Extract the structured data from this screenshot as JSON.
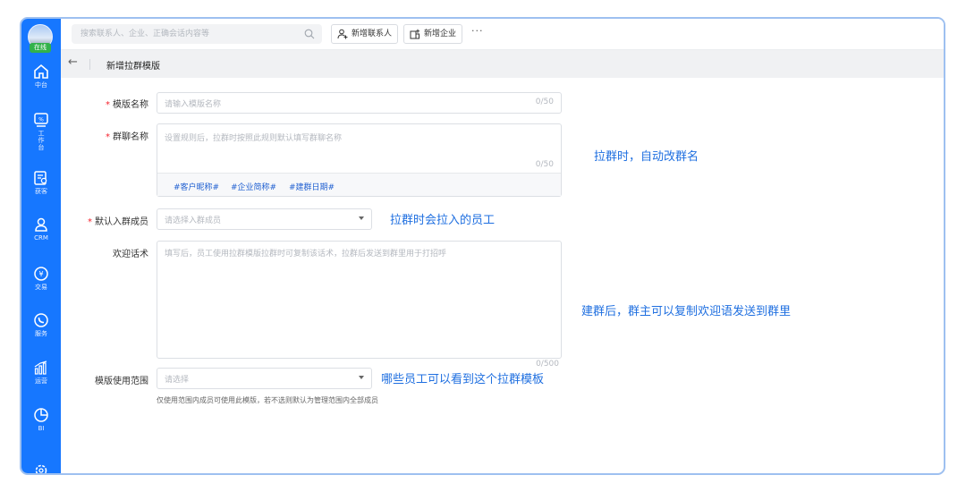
{
  "sidebar": {
    "status": "在线",
    "items": [
      {
        "label": "中台",
        "icon": "home-icon"
      },
      {
        "label": "工作台",
        "icon": "workbench-icon"
      },
      {
        "label": "获客",
        "icon": "acquire-icon"
      },
      {
        "label": "CRM",
        "icon": "user-icon"
      },
      {
        "label": "交易",
        "icon": "yen-icon"
      },
      {
        "label": "服务",
        "icon": "phone-chat-icon"
      },
      {
        "label": "运营",
        "icon": "bar-chart-icon"
      },
      {
        "label": "BI",
        "icon": "pie-chart-icon"
      }
    ]
  },
  "topbar": {
    "search_placeholder": "搜索联系人、企业、正确会话内容等",
    "add_contact": "新增联系人",
    "add_company": "新增企业",
    "more": "···"
  },
  "subheader": {
    "back": "←",
    "title": "新增拉群模版"
  },
  "form": {
    "template_name": {
      "label": "模版名称",
      "placeholder": "请输入模版名称",
      "count": "0/50"
    },
    "group_name": {
      "label": "群聊名称",
      "placeholder": "设置规则后，拉群时按照此规则默认填写群聊名称",
      "count": "0/50",
      "tags": [
        "#客户昵称#",
        "#企业简称#",
        "#建群日期#"
      ]
    },
    "default_members": {
      "label": "默认入群成员",
      "placeholder": "请选择入群成员"
    },
    "welcome": {
      "label": "欢迎话术",
      "placeholder": "填写后，员工使用拉群模版拉群时可复制该话术，拉群后发送到群里用于打招呼",
      "count": "0/500"
    },
    "scope": {
      "label": "模版使用范围",
      "placeholder": "请选择",
      "hint": "仅使用范围内成员可使用此模版，若不选则默认为管理范围内全部成员"
    }
  },
  "annotations": {
    "group_name_note": "拉群时，自动改群名",
    "members_note": "拉群时会拉入的员工",
    "welcome_note": "建群后，群主可以复制欢迎语发送到群里",
    "scope_note": "哪些员工可以看到这个拉群模板"
  },
  "colors": {
    "sidebar": "#1677ff",
    "accent": "#1f6fe0",
    "required": "#f5222d"
  }
}
